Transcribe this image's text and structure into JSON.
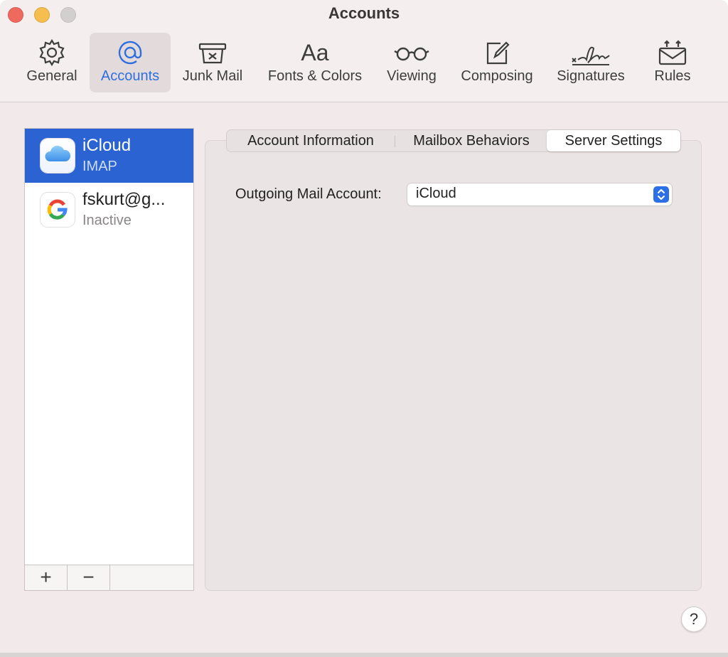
{
  "window": {
    "title": "Accounts"
  },
  "toolbar": {
    "items": [
      {
        "label": "General",
        "icon": "gear-icon"
      },
      {
        "label": "Accounts",
        "icon": "at-sign-icon"
      },
      {
        "label": "Junk Mail",
        "icon": "junk-bin-icon"
      },
      {
        "label": "Fonts & Colors",
        "icon": "font-aa-icon",
        "glyph": "Aa"
      },
      {
        "label": "Viewing",
        "icon": "glasses-icon"
      },
      {
        "label": "Composing",
        "icon": "compose-icon"
      },
      {
        "label": "Signatures",
        "icon": "signature-icon"
      },
      {
        "label": "Rules",
        "icon": "rules-envelope-icon"
      }
    ],
    "active": "Accounts",
    "accent": "#2e6fe0"
  },
  "accounts": [
    {
      "name": "iCloud",
      "subtitle": "IMAP",
      "icon": "icloud-icon",
      "selected": true
    },
    {
      "name": "fskurt@g...",
      "subtitle": "Inactive",
      "icon": "google-icon",
      "selected": false
    }
  ],
  "list_footer": {
    "add": "+",
    "remove": "−"
  },
  "tabs": [
    {
      "label": "Account Information"
    },
    {
      "label": "Mailbox Behaviors"
    },
    {
      "label": "Server Settings"
    }
  ],
  "active_tab": "Server Settings",
  "server_settings": {
    "outgoing_label": "Outgoing Mail Account:",
    "outgoing_value": "iCloud"
  },
  "help": {
    "label": "?"
  },
  "colors": {
    "selection": "#2b64d2",
    "stepper": "#2c6fe6",
    "close": "#ee6a5f",
    "minimize": "#f5be4f"
  }
}
